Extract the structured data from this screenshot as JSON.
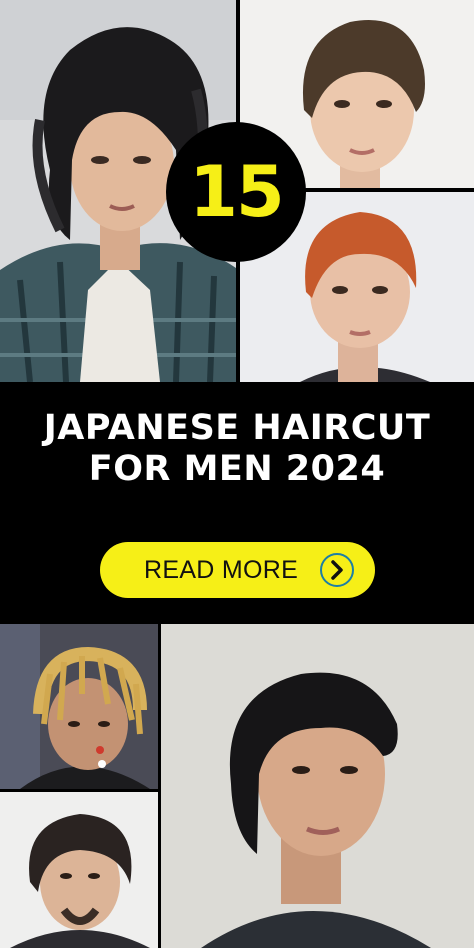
{
  "badge": {
    "number": "15"
  },
  "headline": {
    "line1": "JAPANESE HAIRCUT",
    "line2": "FOR MEN 2024"
  },
  "cta": {
    "label": "READ MORE",
    "icon": "chevron-right-icon"
  },
  "colors": {
    "accent": "#f6ef17",
    "background": "#000000",
    "text": "#ffffff"
  }
}
